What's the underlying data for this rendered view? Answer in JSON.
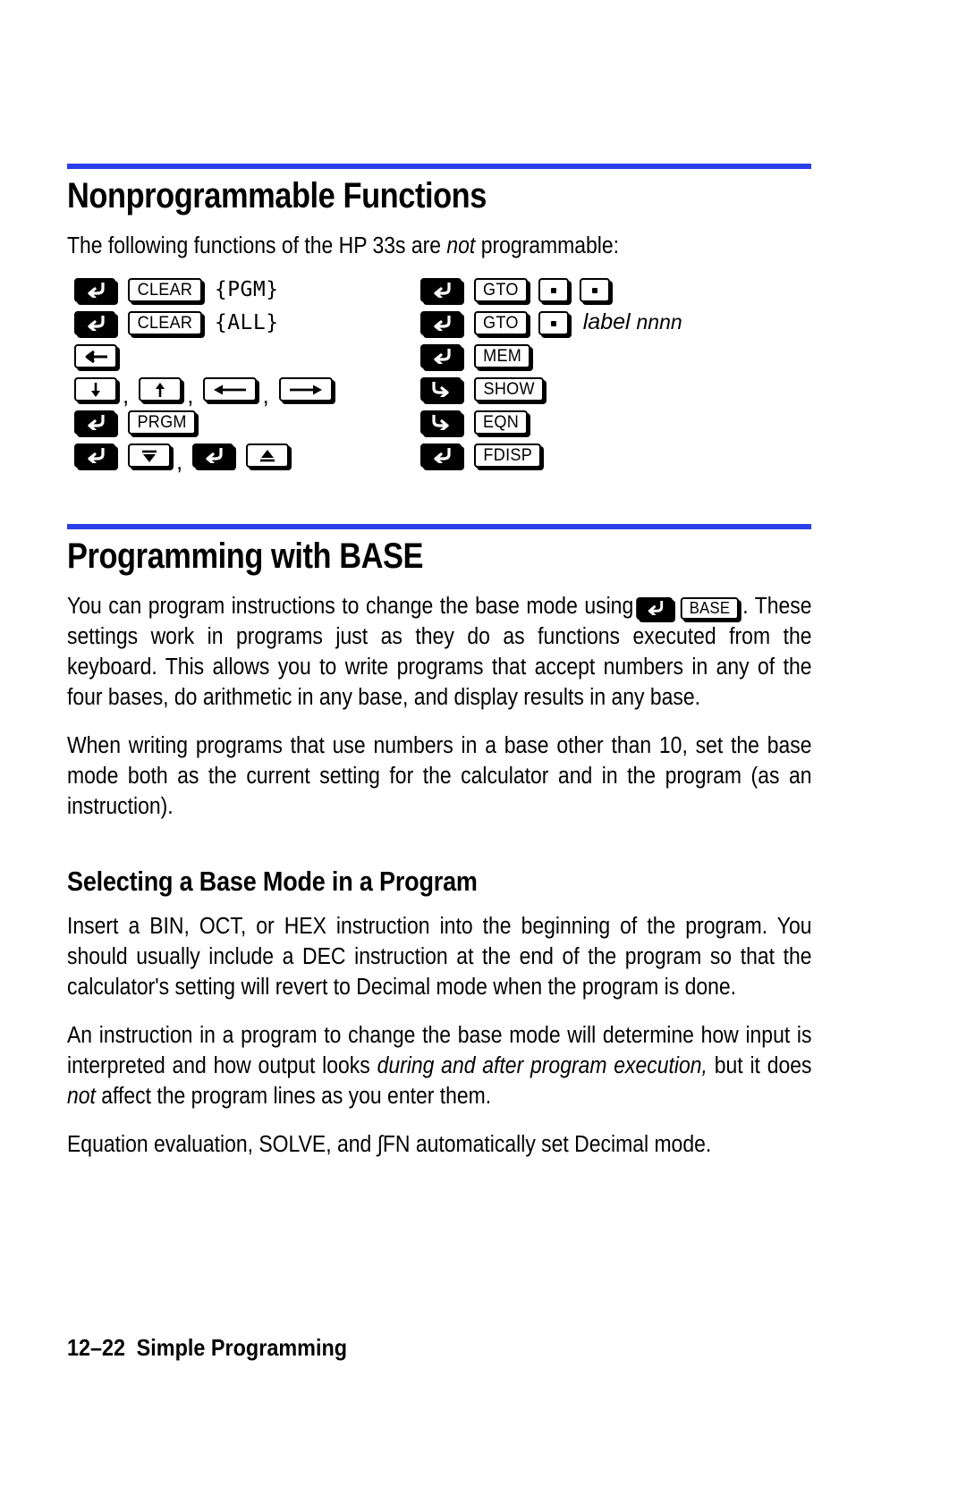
{
  "page": {
    "footer_page_number": "12–22",
    "footer_chapter": "Simple Programming",
    "rule_color": "#2B3FE8"
  },
  "section1": {
    "heading": "Nonprogrammable Functions",
    "intro_before": "The following functions of the HP 33s are ",
    "intro_italic": "not",
    "intro_after": " programmable:",
    "keys_left": [
      {
        "shift": "left-shift",
        "key1": "CLEAR",
        "display": "{PGM}"
      },
      {
        "shift": "left-shift",
        "key1": "CLEAR",
        "display": "{ALL}"
      },
      {
        "key1": "backspace-arrow"
      },
      {
        "key1": "down-arrow",
        "key2": "up-arrow",
        "key3": "left-arrow",
        "key4": "right-arrow"
      },
      {
        "shift": "left-shift",
        "key1": "PRGM"
      },
      {
        "shift": "left-shift",
        "key1": "roll-down",
        "shift2": "left-shift",
        "key2": "roll-up"
      }
    ],
    "keys_right": [
      {
        "shift": "left-shift",
        "key1": "GTO",
        "key2": "dot",
        "key3": "dot"
      },
      {
        "shift": "left-shift",
        "key1": "GTO",
        "key2": "dot",
        "italic": "label",
        "italic2": " nnnn"
      },
      {
        "shift": "left-shift",
        "key1": "MEM"
      },
      {
        "shift": "right-shift",
        "key1": "SHOW"
      },
      {
        "shift": "right-shift",
        "key1": "EQN"
      },
      {
        "shift": "left-shift",
        "key1": "FDISP"
      }
    ],
    "labels": {
      "clear": "CLEAR",
      "pgm_display": "{PGM}",
      "all_display": "{ALL}",
      "prgm": "PRGM",
      "gto": "GTO",
      "mem": "MEM",
      "show": "SHOW",
      "eqn": "EQN",
      "fdisp": "FDISP",
      "label_italic": "label",
      "nnnn_italic": "nnnn",
      "comma": ","
    }
  },
  "section2": {
    "heading": "Programming with BASE",
    "para1_a": "You can program instructions to change the base mode using ",
    "para1_inline_key": "BASE",
    "para1_b": ". These settings work in programs just as they do as functions executed from the keyboard. This allows you to write programs that accept numbers in any of the four bases, do arithmetic in any base, and display results in any base.",
    "para2": "When writing programs that use numbers in a base other than 10, set the base mode both as the current setting for the calculator and in the program (as an instruction).",
    "subheading": "Selecting a Base Mode in a Program",
    "para3": "Insert a BIN, OCT, or HEX instruction into the beginning of the program. You should usually include a DEC instruction at the end of the program so that the calculator's setting will revert to Decimal mode when the program is done.",
    "para4_a": "An instruction in a program to change the base mode will determine how input is interpreted and how output looks ",
    "para4_italic": "during and after program execution,",
    "para4_b": " but it does ",
    "para4_italic2": "not",
    "para4_c": " affect the program lines as you enter them.",
    "para5": "Equation evaluation, SOLVE, and  ∫FN automatically set Decimal mode."
  }
}
